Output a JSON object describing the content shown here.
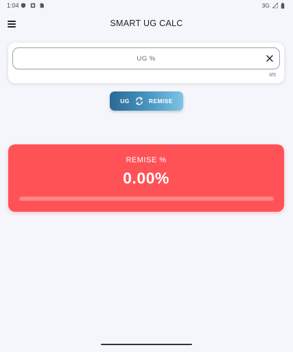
{
  "status_bar": {
    "time": "1:04",
    "network": "3G"
  },
  "app_bar": {
    "title": "SMART UG CALC",
    "menu_icon": "menu-icon"
  },
  "input": {
    "placeholder": "UG %",
    "value": "",
    "counter": "0/5",
    "clear_icon": "close-icon"
  },
  "toggle": {
    "left_label": "UG",
    "right_label": "REMISE",
    "icon": "swap-icon"
  },
  "result": {
    "label": "REMISE %",
    "value": "0.00%",
    "progress": 0
  },
  "colors": {
    "accent_red": "#ff5257",
    "toggle_gradient_start": "#2a6a94",
    "toggle_gradient_end": "#7fc4e6",
    "background": "#f4f6fb"
  }
}
